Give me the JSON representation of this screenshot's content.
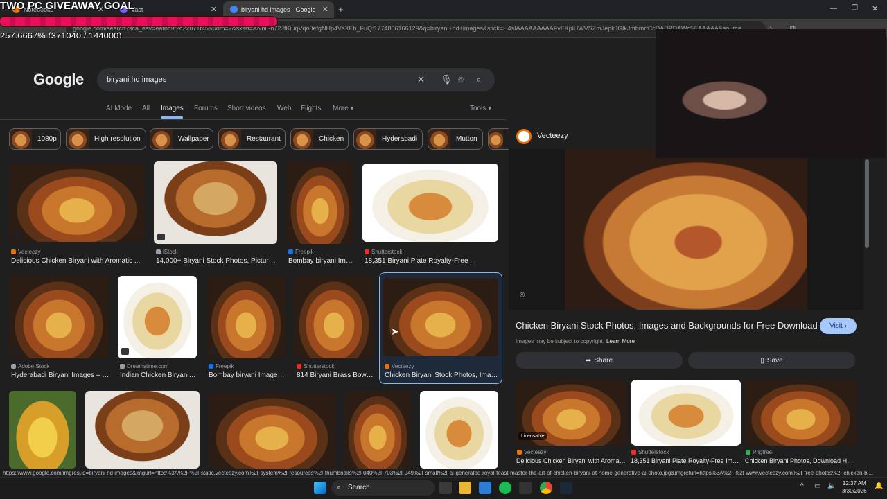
{
  "overlay": {
    "goal_title": "TWO PC GIVEAWAY GOAL",
    "goal_count": "257.6667% (371040 / 144000)",
    "progress_fraction": 1.0
  },
  "browser": {
    "tabs": [
      {
        "label": "Notebooks",
        "active": false
      },
      {
        "label": "Vast",
        "active": false
      },
      {
        "label": "biryani hd images - Google Sea",
        "active": true
      }
    ],
    "new_tab": "+",
    "url": "google.com/search?sca_esv=eafbc9f2c22871f45&udm=2&sxsrf=ANbL-n72JfKiuqVqo0efgNHp4VsXEh_FuQ:1774856166129&q=biryani+hd+images&stick=H4sIAAAAAAAAAFvEKpiUWVSZmJepkJGlkJmbmrfCcDADPDAWc5EAAAAA&source",
    "status_url": "https://www.google.com/imgres?q=biryani hd images&imgurl=https%3A%2F%2Fstatic.vecteezy.com%2Fsystem%2Fresources%2Fthumbnails%2F040%2F703%2F949%2Fsmall%2Fai-generated-royal-feast-master-the-art-of-chicken-biryani-at-home-generative-ai-photo.jpg&imgrefurl=https%3A%2F%2Fwww.vecteezy.com%2Ffree-photos%2Fchicken-bi..."
  },
  "search": {
    "logo": "Google",
    "query": "biryani hd images",
    "tabs": [
      "AI Mode",
      "All",
      "Images",
      "Forums",
      "Short videos",
      "Web",
      "Flights",
      "More ▾"
    ],
    "active_tab": "Images",
    "tools": "Tools ▾",
    "chips": [
      "1080p",
      "High resolution",
      "Wallpaper",
      "Restaurant",
      "Chicken",
      "Hyderabadi",
      "Mutton"
    ]
  },
  "results": {
    "row1": [
      {
        "source": "Vecteezy",
        "caption": "Delicious Chicken Biryani with Aromatic ...",
        "color": "#e8710a"
      },
      {
        "source": "iStock",
        "caption": "14,000+ Biryani Stock Photos, Pictures...",
        "color": "#9aa0a6"
      },
      {
        "source": "Freepik",
        "caption": "Bombay biryani Ima...",
        "color": "#1273eb"
      },
      {
        "source": "Shutterstock",
        "caption": "18,351 Biryani Plate Royalty-Free ...",
        "color": "#ee2b24"
      }
    ],
    "row2": [
      {
        "source": "Adobe Stock",
        "caption": "Hyderabadi Biryani Images – B...",
        "color": "#9aa0a6"
      },
      {
        "source": "Dreamstime.com",
        "caption": "Indian Chicken Biryani S...",
        "color": "#9aa0a6"
      },
      {
        "source": "Freepik",
        "caption": "Bombay biryani Images ...",
        "color": "#1273eb"
      },
      {
        "source": "Shutterstock",
        "caption": "814 Biryani Brass Bowl ...",
        "color": "#ee2b24"
      },
      {
        "source": "Vecteezy",
        "caption": "Chicken Biryani Stock Photos, Imag...",
        "color": "#e8710a"
      }
    ]
  },
  "panel": {
    "source": "Vecteezy",
    "title": "Chicken Biryani Stock Photos, Images and Backgrounds for Free Download",
    "visit": "Visit ›",
    "copyright": "Images may be subject to copyright.",
    "learn_more": "Learn More",
    "share": "Share",
    "save": "Save",
    "licensable": "Licensable",
    "related": [
      {
        "source": "Vecteezy",
        "caption": "Delicious Chicken Biryani with Aromati...",
        "color": "#e8710a"
      },
      {
        "source": "Shutterstock",
        "caption": "18,351 Biryani Plate Royalty-Free Image...",
        "color": "#ee2b24"
      },
      {
        "source": "Pngtree",
        "caption": "Chicken Biryani Photos, Download HD...",
        "color": "#34a853"
      }
    ]
  },
  "taskbar": {
    "search": "Search",
    "time": "12:37 AM",
    "date": "3/30/2026"
  }
}
